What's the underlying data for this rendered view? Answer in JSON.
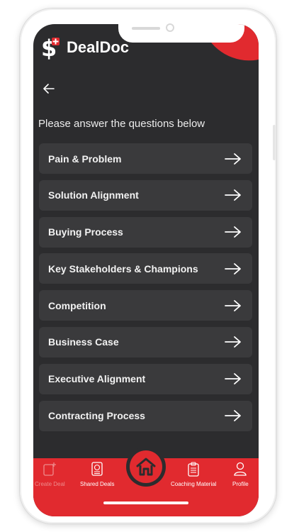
{
  "app": {
    "name": "DealDoc"
  },
  "header": {
    "back_icon": "arrow-left-icon"
  },
  "prompt": "Please answer the questions below",
  "questions": [
    {
      "label": "Pain & Problem"
    },
    {
      "label": "Solution Alignment"
    },
    {
      "label": "Buying Process"
    },
    {
      "label": "Key Stakeholders & Champions"
    },
    {
      "label": "Competition"
    },
    {
      "label": "Business Case"
    },
    {
      "label": "Executive Alignment"
    },
    {
      "label": "Contracting Process"
    }
  ],
  "tabbar": {
    "create_deal": "Create Deal",
    "shared_deals": "Shared Deals",
    "coaching_material": "Coaching Material",
    "profile": "Profile"
  },
  "colors": {
    "accent": "#e12a2f",
    "screen_bg": "#2c2c2e",
    "card_bg": "#3a3a3c"
  }
}
